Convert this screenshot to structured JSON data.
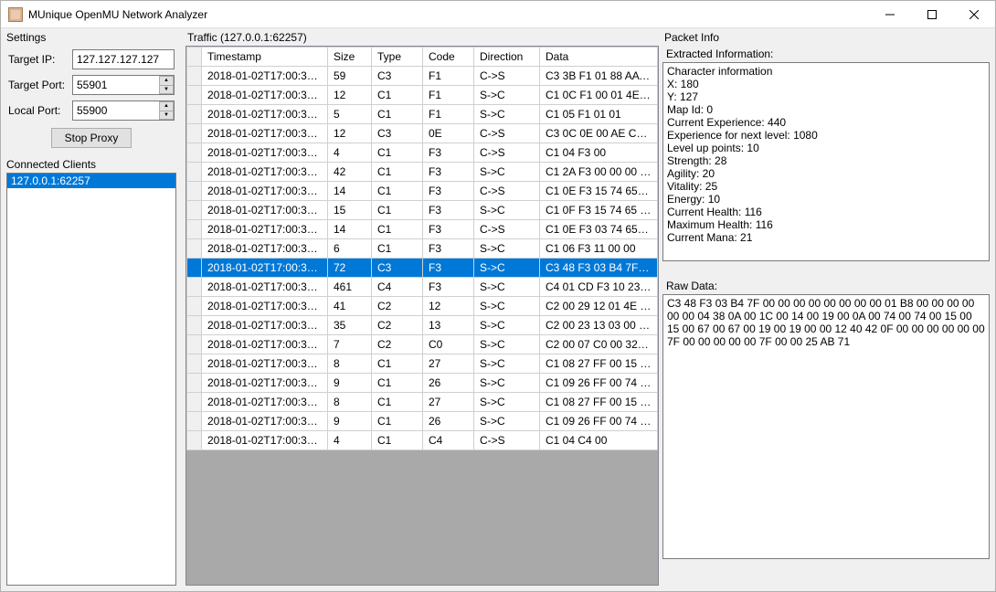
{
  "window": {
    "title": "MUnique OpenMU Network Analyzer"
  },
  "settings": {
    "group_label": "Settings",
    "target_ip_label": "Target IP:",
    "target_ip_value": "127.127.127.127",
    "target_port_label": "Target Port:",
    "target_port_value": "55901",
    "local_port_label": "Local Port:",
    "local_port_value": "55900",
    "proxy_button_label": "Stop Proxy"
  },
  "clients": {
    "group_label": "Connected Clients",
    "items": [
      "127.0.0.1:62257"
    ]
  },
  "traffic": {
    "group_label": "Traffic (127.0.0.1:62257)",
    "columns": {
      "timestamp": "Timestamp",
      "size": "Size",
      "type": "Type",
      "code": "Code",
      "direction": "Direction",
      "data": "Data"
    },
    "selected_index": 10,
    "rows": [
      {
        "timestamp": "2018-01-02T17:00:32....",
        "size": "59",
        "type": "C3",
        "code": "F1",
        "direction": "C->S",
        "data": "C3 3B F1 01 88 AA D8 8..."
      },
      {
        "timestamp": "2018-01-02T17:00:32....",
        "size": "12",
        "type": "C1",
        "code": "F1",
        "direction": "S->C",
        "data": "C1 0C F1 00 01 4E 34 31..."
      },
      {
        "timestamp": "2018-01-02T17:00:33....",
        "size": "5",
        "type": "C1",
        "code": "F1",
        "direction": "S->C",
        "data": "C1 05 F1 01 01"
      },
      {
        "timestamp": "2018-01-02T17:00:33....",
        "size": "12",
        "type": "C3",
        "code": "0E",
        "direction": "C->S",
        "data": "C3 0C 0E 00 AE CE B4 4..."
      },
      {
        "timestamp": "2018-01-02T17:00:33....",
        "size": "4",
        "type": "C1",
        "code": "F3",
        "direction": "C->S",
        "data": "C1 04 F3 00"
      },
      {
        "timestamp": "2018-01-02T17:00:33....",
        "size": "42",
        "type": "C1",
        "code": "F3",
        "direction": "S->C",
        "data": "C1 2A F3 00 00 00 01 00..."
      },
      {
        "timestamp": "2018-01-02T17:00:33....",
        "size": "14",
        "type": "C1",
        "code": "F3",
        "direction": "C->S",
        "data": "C1 0E F3 15 74 65 73 74..."
      },
      {
        "timestamp": "2018-01-02T17:00:33....",
        "size": "15",
        "type": "C1",
        "code": "F3",
        "direction": "S->C",
        "data": "C1 0F F3 15 74 65 73 74..."
      },
      {
        "timestamp": "2018-01-02T17:00:33....",
        "size": "14",
        "type": "C1",
        "code": "F3",
        "direction": "C->S",
        "data": "C1 0E F3 03 74 65 73 74..."
      },
      {
        "timestamp": "2018-01-02T17:00:33....",
        "size": "6",
        "type": "C1",
        "code": "F3",
        "direction": "S->C",
        "data": "C1 06 F3 11 00 00"
      },
      {
        "timestamp": "2018-01-02T17:00:33....",
        "size": "72",
        "type": "C3",
        "code": "F3",
        "direction": "S->C",
        "data": "C3 48 F3 03 B4 7F 00 00..."
      },
      {
        "timestamp": "2018-01-02T17:00:33....",
        "size": "461",
        "type": "C4",
        "code": "F3",
        "direction": "S->C",
        "data": "C4 01 CD F3 10 23 1D 1..."
      },
      {
        "timestamp": "2018-01-02T17:00:33....",
        "size": "41",
        "type": "C2",
        "code": "12",
        "direction": "S->C",
        "data": "C2 00 29 12 01 4E 34 B4..."
      },
      {
        "timestamp": "2018-01-02T17:00:33....",
        "size": "35",
        "type": "C2",
        "code": "13",
        "direction": "S->C",
        "data": "C2 00 23 13 03 00 0C 00..."
      },
      {
        "timestamp": "2018-01-02T17:00:33....",
        "size": "7",
        "type": "C2",
        "code": "C0",
        "direction": "S->C",
        "data": "C2 00 07 C0 00 32 00"
      },
      {
        "timestamp": "2018-01-02T17:00:34....",
        "size": "8",
        "type": "C1",
        "code": "27",
        "direction": "S->C",
        "data": "C1 08 27 FF 00 15 00 19"
      },
      {
        "timestamp": "2018-01-02T17:00:34....",
        "size": "9",
        "type": "C1",
        "code": "26",
        "direction": "S->C",
        "data": "C1 09 26 FF 00 74 00 00..."
      },
      {
        "timestamp": "2018-01-02T17:00:37....",
        "size": "8",
        "type": "C1",
        "code": "27",
        "direction": "S->C",
        "data": "C1 08 27 FF 00 15 00 19"
      },
      {
        "timestamp": "2018-01-02T17:00:37....",
        "size": "9",
        "type": "C1",
        "code": "26",
        "direction": "S->C",
        "data": "C1 09 26 FF 00 74 00 00..."
      },
      {
        "timestamp": "2018-01-02T17:00:38....",
        "size": "4",
        "type": "C1",
        "code": "C4",
        "direction": "C->S",
        "data": "C1 04 C4 00"
      }
    ]
  },
  "packet_info": {
    "group_label": "Packet Info",
    "extracted_label": "Extracted Information:",
    "extracted_text": "Character information\nX: 180\nY: 127\nMap Id: 0\nCurrent Experience: 440\nExperience for next level: 1080\nLevel up points: 10\nStrength: 28\nAgility: 20\nVitality: 25\nEnergy: 10\nCurrent Health: 116\nMaximum Health: 116\nCurrent Mana: 21",
    "raw_label": "Raw Data:",
    "raw_text": "C3 48 F3 03 B4 7F 00 00 00 00 00 00 00 00 01 B8 00 00 00 00 00 00 04 38 0A 00 1C 00 14 00 19 00 0A 00 74 00 74 00 15 00 15 00 67 00 67 00 19 00 19 00 00 12 40 42 0F 00 00 00 00 00 00 7F 00 00 00 00 00 7F 00 00 25 AB 71"
  }
}
